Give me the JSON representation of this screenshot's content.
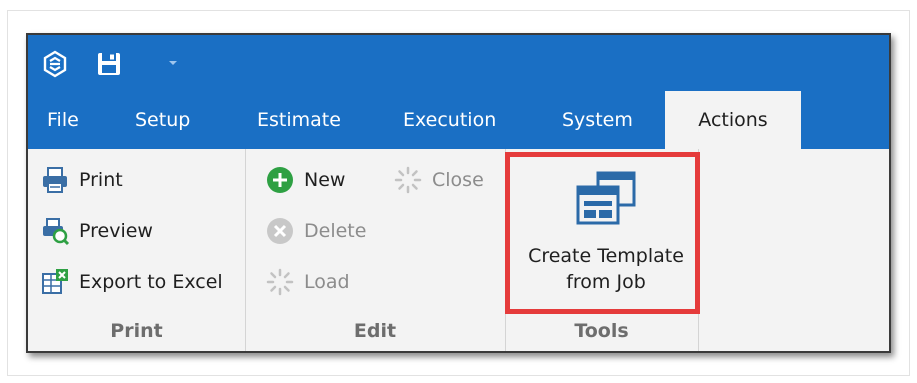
{
  "tabs": {
    "file": "File",
    "setup": "Setup",
    "estimate": "Estimate",
    "execution": "Execution",
    "system": "System",
    "actions": "Actions"
  },
  "ribbon": {
    "print_group": {
      "label": "Print",
      "print": "Print",
      "preview": "Preview",
      "export": "Export to Excel"
    },
    "edit_group": {
      "label": "Edit",
      "new": "New",
      "close": "Close",
      "delete": "Delete",
      "load": "Load"
    },
    "tools_group": {
      "label": "Tools",
      "create_template_line1": "Create Template",
      "create_template_line2": "from Job"
    }
  },
  "icons": {
    "logo": "app-logo-icon",
    "save": "save-icon",
    "dropdown": "chevron-down-icon",
    "print": "printer-icon",
    "preview": "print-preview-icon",
    "export": "excel-export-icon",
    "new": "plus-circle-icon",
    "close": "spinner-icon",
    "delete": "x-circle-icon",
    "load": "spinner-icon",
    "create_template": "template-windows-icon"
  },
  "colors": {
    "title_bar": "#1a6fc4",
    "ribbon_bg": "#f3f3f3",
    "highlight": "#e53b3b",
    "new_icon": "#2ea043"
  }
}
